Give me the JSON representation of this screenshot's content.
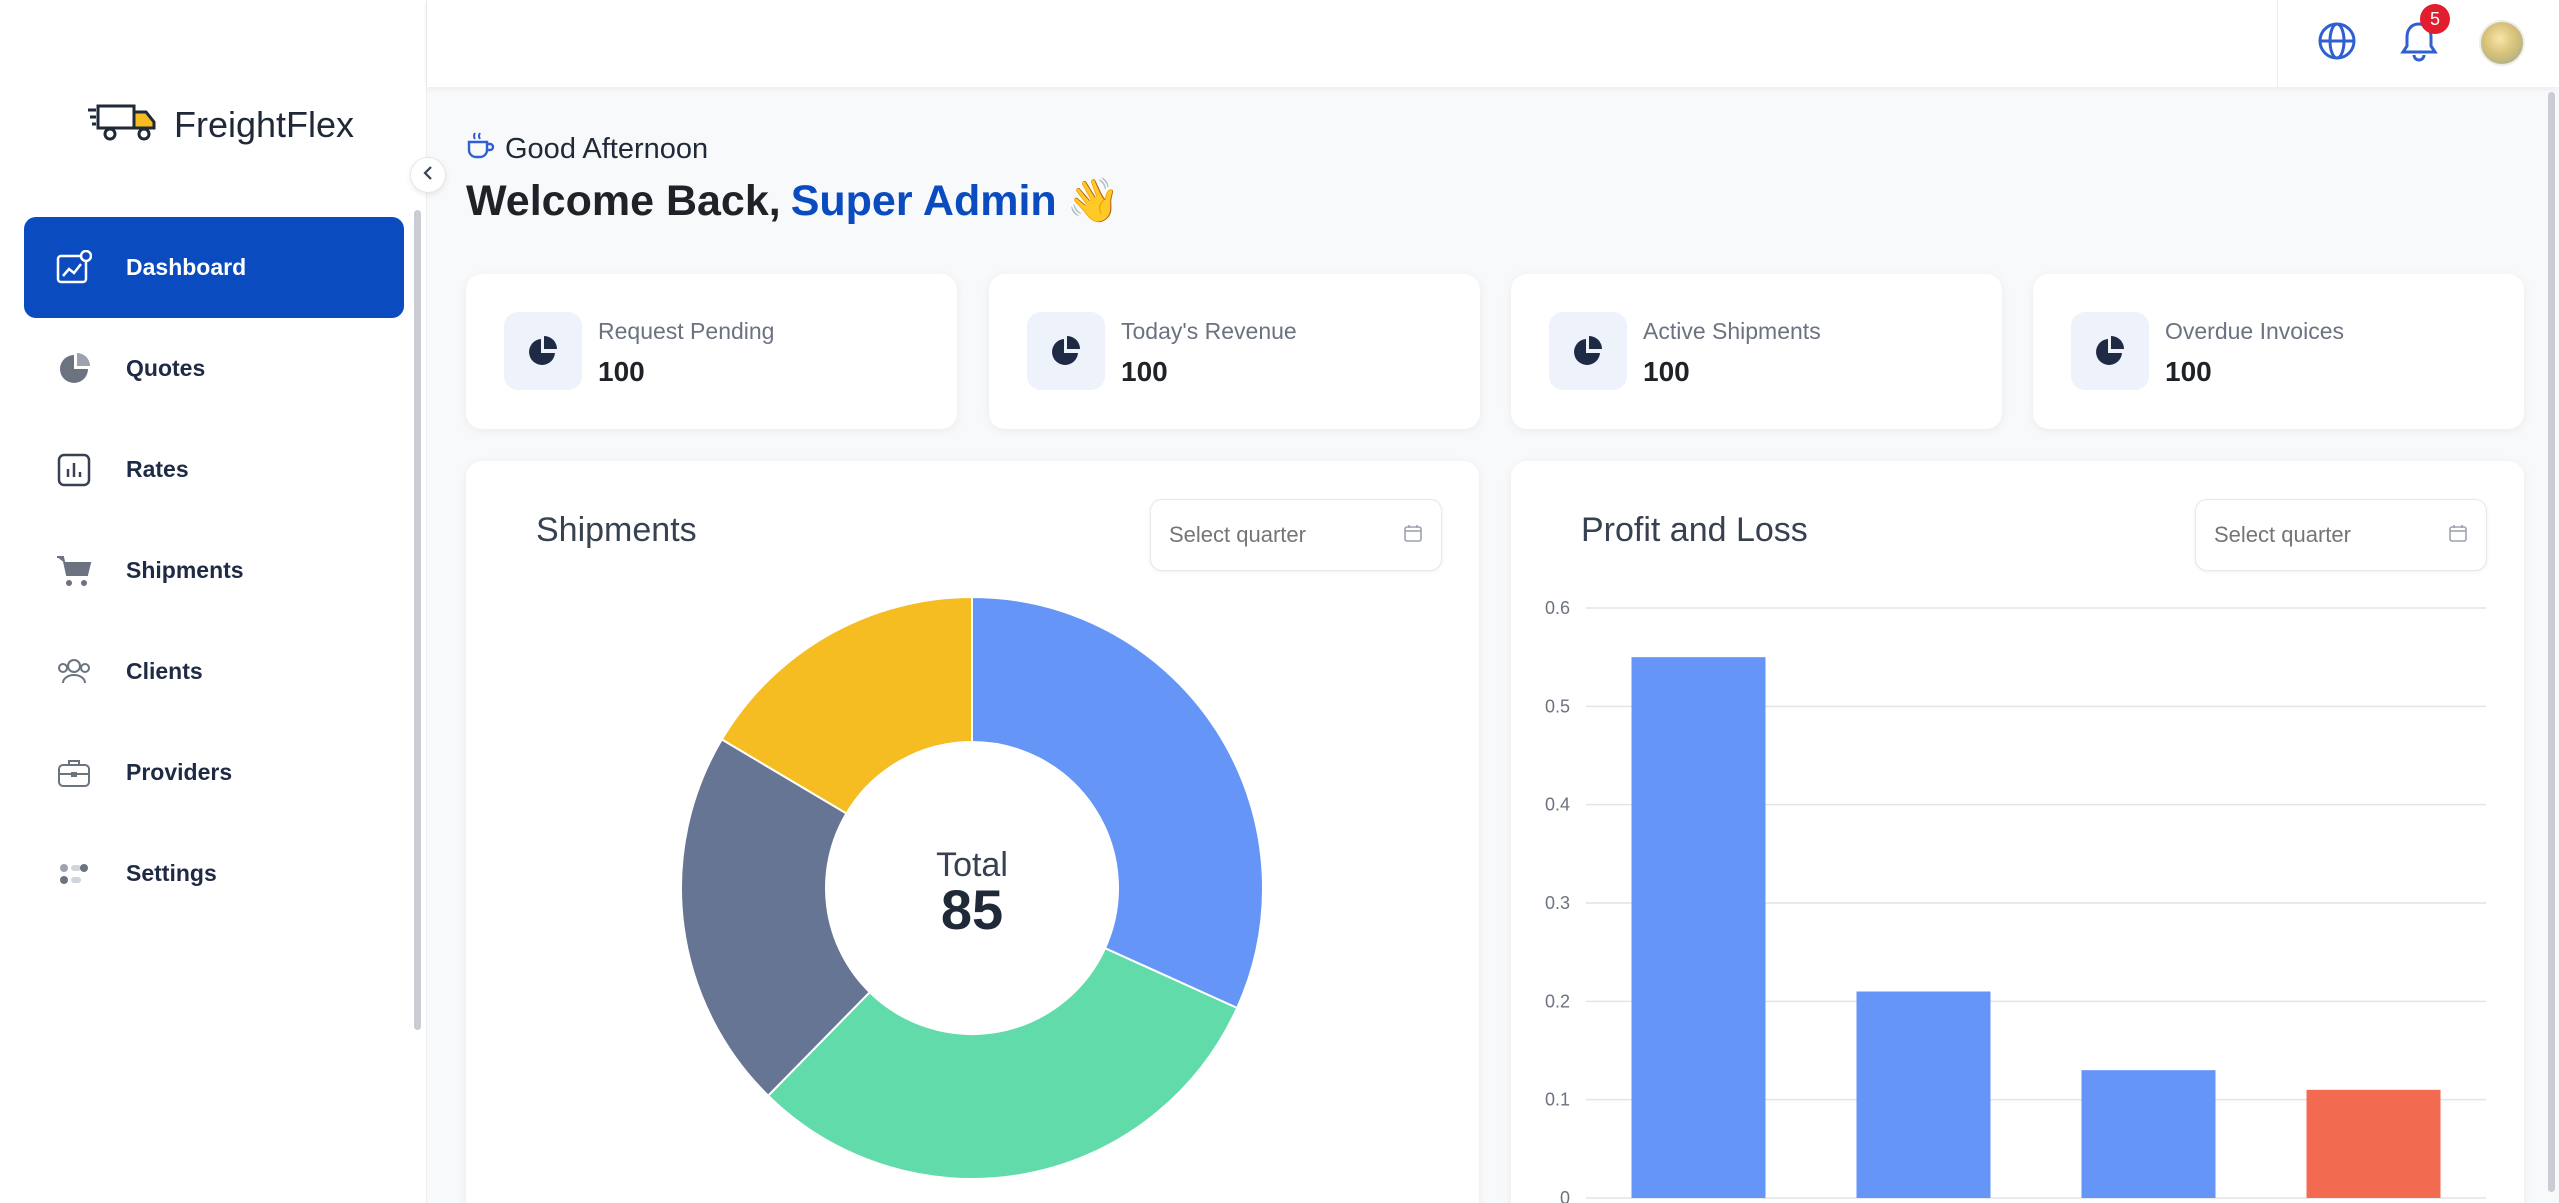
{
  "brand": {
    "name": "FreightFlex"
  },
  "sidebar": {
    "items": [
      {
        "label": "Dashboard",
        "icon": "dashboard-icon",
        "active": true
      },
      {
        "label": "Quotes",
        "icon": "pie-icon"
      },
      {
        "label": "Rates",
        "icon": "bar-chart-icon"
      },
      {
        "label": "Shipments",
        "icon": "cart-icon"
      },
      {
        "label": "Clients",
        "icon": "users-icon"
      },
      {
        "label": "Providers",
        "icon": "briefcase-icon"
      },
      {
        "label": "Settings",
        "icon": "settings-icon"
      }
    ]
  },
  "topbar": {
    "notification_count": "5"
  },
  "greeting": {
    "text": "Good Afternoon",
    "welcome_prefix": "Welcome Back,",
    "user_name": "Super Admin",
    "emoji": "👋"
  },
  "stats": [
    {
      "label": "Request Pending",
      "value": "100"
    },
    {
      "label": "Today's Revenue",
      "value": "100"
    },
    {
      "label": "Active Shipments",
      "value": "100"
    },
    {
      "label": "Overdue Invoices",
      "value": "100"
    }
  ],
  "shipments_panel": {
    "title": "Shipments",
    "select_placeholder": "Select quarter",
    "center_label": "Total",
    "center_value": "85"
  },
  "pnl_panel": {
    "title": "Profit and Loss",
    "select_placeholder": "Select quarter"
  },
  "colors": {
    "accent": "#0a4bbf",
    "blue": "#6495f7",
    "green": "#62dbab",
    "slate": "#657593",
    "yellow": "#f5bd22",
    "red": "#f26b50"
  },
  "chart_data": [
    {
      "type": "pie",
      "title": "Shipments",
      "total": 85,
      "values": [
        27,
        26,
        18,
        14
      ],
      "colors": [
        "#6495f7",
        "#62dbab",
        "#657593",
        "#f5bd22"
      ]
    },
    {
      "type": "bar",
      "title": "Profit and Loss",
      "values": [
        0.55,
        0.21,
        0.13,
        0.11
      ],
      "colors": [
        "#6495f7",
        "#6495f7",
        "#6495f7",
        "#f26b50"
      ],
      "yticks": [
        "0",
        "0.1",
        "0.2",
        "0.3",
        "0.4",
        "0.5",
        "0.6"
      ],
      "ylim": [
        0,
        0.6
      ],
      "grid": true
    }
  ]
}
